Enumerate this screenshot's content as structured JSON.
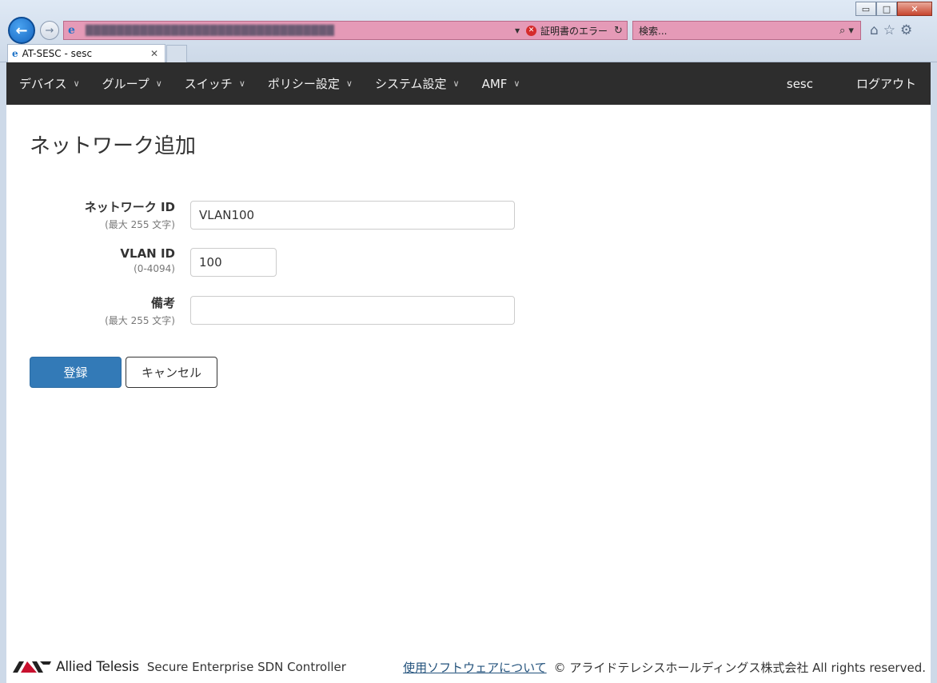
{
  "browser": {
    "address_error": "証明書のエラー",
    "search_placeholder": "検索...",
    "tab_title": "AT-SESC - sesc",
    "window_buttons": {
      "minimize": "▭",
      "maximize": "□",
      "close": "✕"
    }
  },
  "navbar": {
    "items": [
      {
        "label": "デバイス"
      },
      {
        "label": "グループ"
      },
      {
        "label": "スイッチ"
      },
      {
        "label": "ポリシー設定"
      },
      {
        "label": "システム設定"
      },
      {
        "label": "AMF"
      }
    ],
    "user": "sesc",
    "logout": "ログアウト"
  },
  "page": {
    "title": "ネットワーク追加"
  },
  "form": {
    "network_id": {
      "label": "ネットワーク ID",
      "hint": "(最大 255 文字)",
      "value": "VLAN100"
    },
    "vlan_id": {
      "label": "VLAN ID",
      "hint": "(0-4094)",
      "value": "100"
    },
    "remarks": {
      "label": "備考",
      "hint": "(最大 255 文字)",
      "value": ""
    },
    "submit_label": "登録",
    "cancel_label": "キャンセル"
  },
  "footer": {
    "brand": "Allied Telesis",
    "product": "Secure Enterprise SDN Controller",
    "software_link": "使用ソフトウェアについて",
    "copyright": "© アライドテレシスホールディングス株式会社 All rights reserved."
  },
  "colors": {
    "navbar_bg": "#2d2d2d",
    "primary": "#337ab7",
    "address_bar": "#e59ab7",
    "link": "#23527c"
  }
}
